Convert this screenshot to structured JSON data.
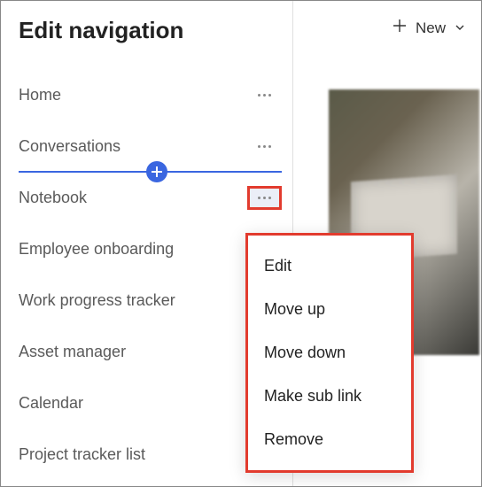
{
  "panel": {
    "title": "Edit navigation",
    "items": [
      {
        "label": "Home"
      },
      {
        "label": "Conversations"
      },
      {
        "label": "Notebook"
      },
      {
        "label": "Employee onboarding"
      },
      {
        "label": "Work progress tracker"
      },
      {
        "label": "Asset manager"
      },
      {
        "label": "Calendar"
      },
      {
        "label": "Project tracker list"
      }
    ]
  },
  "toolbar": {
    "new_label": "New"
  },
  "context_menu": {
    "items": [
      {
        "label": "Edit"
      },
      {
        "label": "Move up"
      },
      {
        "label": "Move down"
      },
      {
        "label": "Make sub link"
      },
      {
        "label": "Remove"
      }
    ]
  }
}
